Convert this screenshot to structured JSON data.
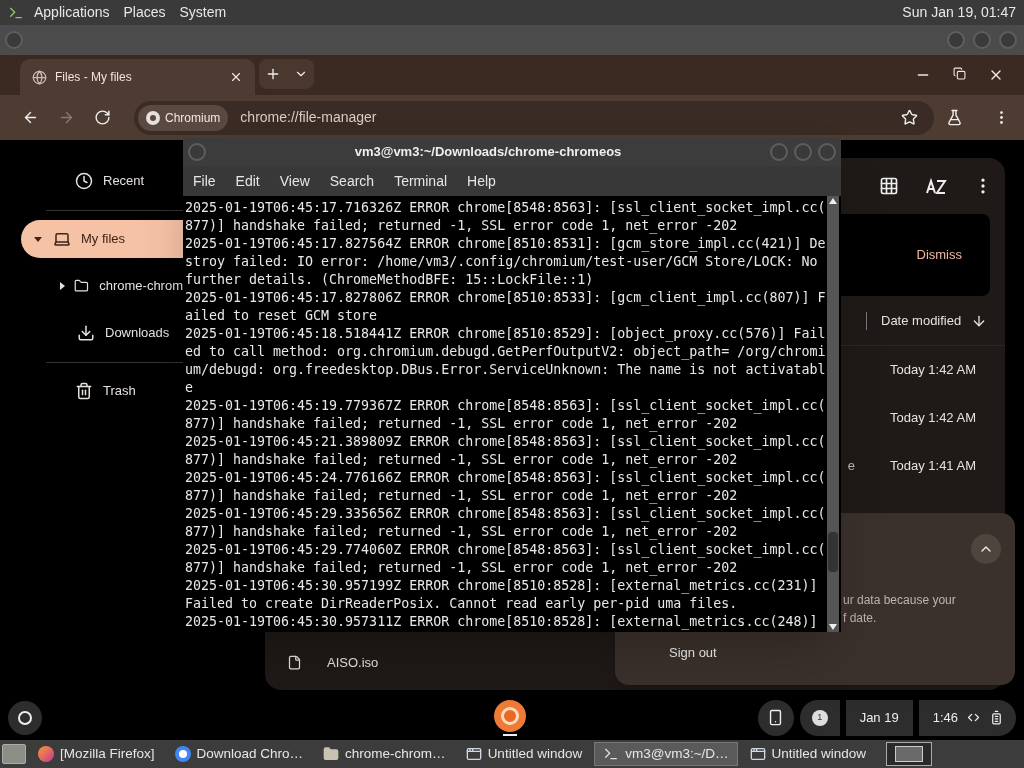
{
  "top_panel": {
    "menus": [
      "Applications",
      "Places",
      "System"
    ],
    "clock": "Sun Jan 19, 01:47"
  },
  "browser": {
    "tabs": [
      {
        "title": "Files - My files",
        "selected": true
      }
    ],
    "nav": [
      {
        "kind": "back",
        "disabled": false
      },
      {
        "kind": "forward",
        "disabled": true
      },
      {
        "kind": "reload",
        "disabled": false
      }
    ],
    "omnibox": {
      "chip": "Chromium",
      "url": "chrome://file-manager"
    }
  },
  "files": {
    "sidebar": [
      {
        "kind": "recent",
        "label": "Recent",
        "selected": false
      },
      {
        "kind": "computer",
        "label": "My files",
        "selected": true,
        "expanded": true,
        "children": [
          {
            "kind": "folder",
            "label": "chrome-chrom",
            "selected": false,
            "expanded": false
          },
          {
            "kind": "download",
            "label": "Downloads",
            "selected": false
          }
        ]
      },
      {
        "kind": "trash",
        "label": "Trash",
        "selected": false
      }
    ],
    "banner": {
      "action": "Dismiss"
    },
    "columns": [
      {
        "label": "Date modified",
        "sorted": true
      }
    ],
    "rows": [
      {
        "modified": "Today 1:42 AM"
      },
      {
        "modified": "Today 1:42 AM"
      },
      {
        "name": "e",
        "modified": "Today 1:41 AM"
      }
    ],
    "last_row": {
      "name": "AISO.iso"
    },
    "account_card": {
      "lines": [
        "ur data because your",
        "f date."
      ],
      "action": "Sign out",
      "expanded": true
    }
  },
  "terminal": {
    "title": "vm3@vm3:~/Downloads/chrome-chromeos",
    "menus": [
      "File",
      "Edit",
      "View",
      "Search",
      "Terminal",
      "Help"
    ],
    "lines": [
      "2025-01-19T06:45:17.716326Z ERROR chrome[8548:8563]: [ssl_client_socket_impl.cc(",
      "877)] handshake failed; returned -1, SSL error code 1, net_error -202",
      "2025-01-19T06:45:17.827564Z ERROR chrome[8510:8531]: [gcm_store_impl.cc(421)] De",
      "stroy failed: IO error: /home/vm3/.config/chromium/test-user/GCM Store/LOCK: No",
      "further details. (ChromeMethodBFE: 15::LockFile::1)",
      "2025-01-19T06:45:17.827806Z ERROR chrome[8510:8533]: [gcm_client_impl.cc(807)] F",
      "ailed to reset GCM store",
      "2025-01-19T06:45:18.518441Z ERROR chrome[8510:8529]: [object_proxy.cc(576)] Fail",
      "ed to call method: org.chromium.debugd.GetPerfOutputV2: object_path= /org/chromi",
      "um/debugd: org.freedesktop.DBus.Error.ServiceUnknown: The name is not activatabl",
      "e",
      "2025-01-19T06:45:19.779367Z ERROR chrome[8548:8563]: [ssl_client_socket_impl.cc(",
      "877)] handshake failed; returned -1, SSL error code 1, net_error -202",
      "2025-01-19T06:45:21.389809Z ERROR chrome[8548:8563]: [ssl_client_socket_impl.cc(",
      "877)] handshake failed; returned -1, SSL error code 1, net_error -202",
      "2025-01-19T06:45:24.776166Z ERROR chrome[8548:8563]: [ssl_client_socket_impl.cc(",
      "877)] handshake failed; returned -1, SSL error code 1, net_error -202",
      "2025-01-19T06:45:29.335656Z ERROR chrome[8548:8563]: [ssl_client_socket_impl.cc(",
      "877)] handshake failed; returned -1, SSL error code 1, net_error -202",
      "2025-01-19T06:45:29.774060Z ERROR chrome[8548:8563]: [ssl_client_socket_impl.cc(",
      "877)] handshake failed; returned -1, SSL error code 1, net_error -202",
      "2025-01-19T06:45:30.957199Z ERROR chrome[8510:8528]: [external_metrics.cc(231)]",
      "Failed to create DirReaderPosix. Cannot read early per-pid uma files.",
      "2025-01-19T06:45:30.957311Z ERROR chrome[8510:8528]: [external_metrics.cc(248)]"
    ]
  },
  "shelf": {
    "notification_count": "1",
    "date": "Jan 19",
    "time": "1:46"
  },
  "taskbar": {
    "items": [
      {
        "kind": "firefox",
        "label": "[Mozilla Firefox]",
        "selected": false
      },
      {
        "kind": "chrome",
        "label": "Download Chro…",
        "selected": false
      },
      {
        "kind": "folder",
        "label": "chrome-chrom…",
        "selected": false
      },
      {
        "kind": "window",
        "label": "Untitled window",
        "selected": false
      },
      {
        "kind": "terminal",
        "label": "vm3@vm3:~/D…",
        "selected": true
      },
      {
        "kind": "window",
        "label": "Untitled window",
        "selected": false
      }
    ]
  }
}
